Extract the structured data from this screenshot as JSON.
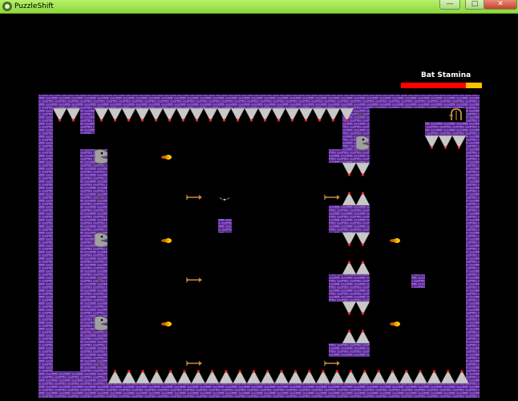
{
  "window": {
    "title": "PuzzleShift"
  },
  "hud": {
    "stamina_label": "Bat Stamina",
    "stamina_fraction": 0.8,
    "stamina_fill_color": "#ff0000",
    "stamina_empty_color": "#ffc000"
  },
  "colors": {
    "wall": "#7a45b8",
    "wall_dark": "#4b2478",
    "spike": "#c8c8c8",
    "spike_tip": "#ff2020",
    "arrow": "#c58a3a",
    "fireball": "#ff7a00",
    "background": "#000000"
  },
  "icons": {
    "app": "puzzle-shift-icon",
    "min": "minimize-icon",
    "max": "maximize-icon",
    "close": "close-icon",
    "door": "exit-door-icon",
    "bat": "bat-icon",
    "serpent": "serpent-head-icon"
  }
}
